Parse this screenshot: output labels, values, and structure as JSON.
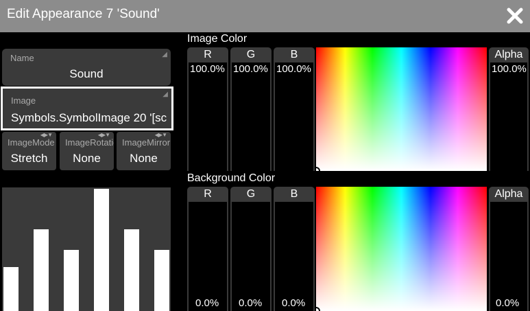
{
  "window": {
    "title": "Edit Appearance 7 'Sound'"
  },
  "left": {
    "name": {
      "label": "Name",
      "value": "Sound"
    },
    "image": {
      "label": "Image",
      "value": "Symbols.SymbolImage 20 '[sc"
    },
    "image_mode": {
      "label": "ImageMode",
      "value": "Stretch"
    },
    "image_rotation": {
      "label": "ImageRotation",
      "value": "None"
    },
    "image_mirror": {
      "label": "ImageMirror",
      "value": "None"
    }
  },
  "preview": {
    "bars": [
      0.36,
      0.67,
      0.5,
      1.0,
      0.67,
      0.5
    ]
  },
  "image_color": {
    "title": "Image Color",
    "r": {
      "label": "R",
      "value": "100.0%"
    },
    "g": {
      "label": "G",
      "value": "100.0%"
    },
    "b": {
      "label": "B",
      "value": "100.0%"
    },
    "alpha": {
      "label": "Alpha",
      "value": "100.0%"
    }
  },
  "background_color": {
    "title": "Background Color",
    "r": {
      "label": "R",
      "value": "0.0%"
    },
    "g": {
      "label": "G",
      "value": "0.0%"
    },
    "b": {
      "label": "B",
      "value": "0.0%"
    },
    "alpha": {
      "label": "Alpha",
      "value": "0.0%"
    }
  },
  "icons": {
    "close": "close-icon",
    "edit_corner": "edit-corner-icon",
    "stepper_arrows": "stepper-arrows-icon"
  }
}
